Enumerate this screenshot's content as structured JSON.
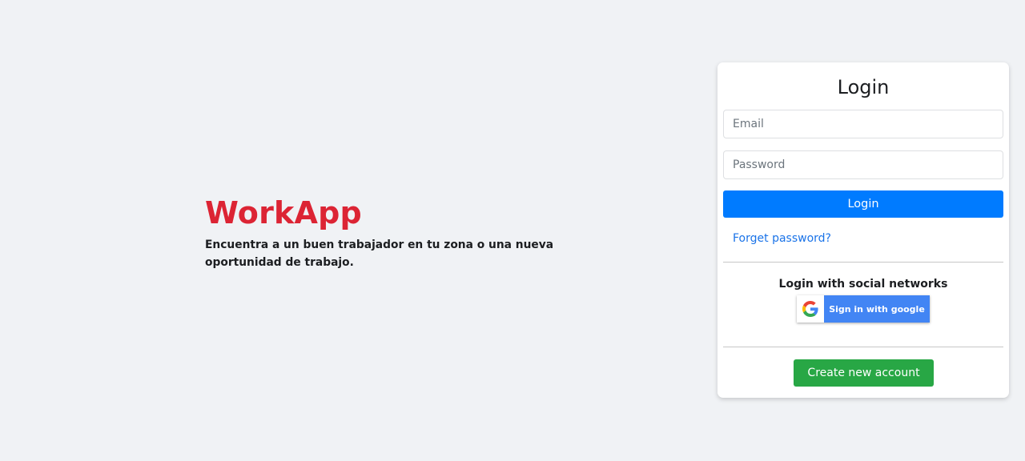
{
  "brand": {
    "title": "WorkApp",
    "tagline": "Encuentra a un buen trabajador en tu zona o una nueva oportunidad de trabajo."
  },
  "login": {
    "title": "Login",
    "email_placeholder": "Email",
    "password_placeholder": "Password",
    "login_button_label": "Login",
    "forget_link": "Forget password?",
    "social_heading": "Login with social networks",
    "google_button_label": "Sign in with google",
    "create_button_label": "Create new account"
  },
  "icons": {
    "google": "google-icon"
  },
  "colors": {
    "background": "#f0f2f5",
    "brand": "#dc2434",
    "primary": "#007bff",
    "link": "#1a73e8",
    "success": "#28a745",
    "google": "#4285f4"
  }
}
